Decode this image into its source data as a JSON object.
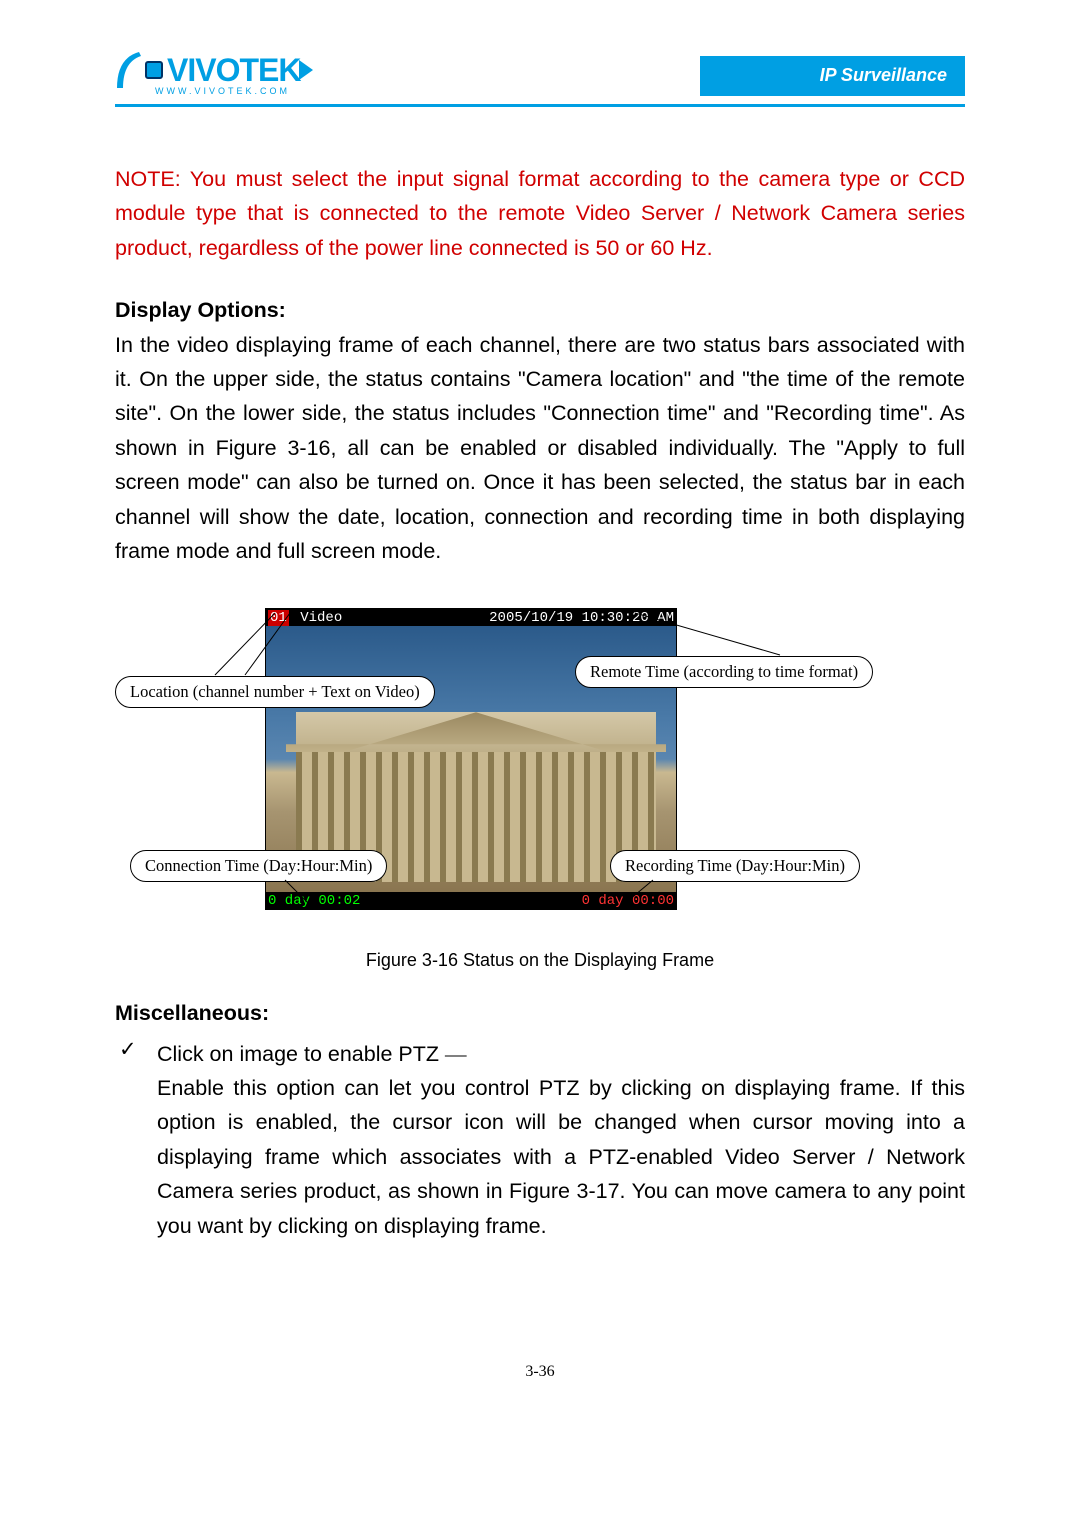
{
  "header": {
    "brand": "VIVOTEK",
    "brand_sub": "WWW.VIVOTEK.COM",
    "tagline": "IP Surveillance"
  },
  "note_text": "NOTE: You must select the input signal format according to the camera type or CCD module type that is connected to the remote Video Server / Network Camera series product, regardless of the power line connected is 50 or 60 Hz.",
  "display_options": {
    "heading": "Display Options:",
    "body": "In the video displaying frame of each channel, there are two status bars associated with it. On the upper side, the status contains \"Camera location\" and \"the time of the remote site\". On the lower side, the status includes \"Connection time\" and \"Recording time\". As shown in Figure 3-16, all can be enabled or disabled individually. The \"Apply to full screen mode\" can also be turned on. Once it has been selected, the status bar in each channel will show the date, location, connection and recording time in both displaying frame mode and full screen mode."
  },
  "figure": {
    "channel_num": "01",
    "channel_label": "Video",
    "remote_time": "2005/10/19 10:30:20 AM",
    "conn_time": "0 day  00:02",
    "rec_time": "0 day  00:00",
    "callout_location": "Location (channel number + Text on Video)",
    "callout_remote": "Remote Time (according to time format)",
    "callout_conn": "Connection Time (Day:Hour:Min)",
    "callout_rec": "Recording Time (Day:Hour:Min)",
    "caption": "Figure 3-16 Status on the Displaying Frame"
  },
  "misc": {
    "heading": "Miscellaneous:",
    "item_label": "Click on image to enable PTZ",
    "item_dash": "—",
    "item_body": "Enable this option can let you control PTZ by clicking on displaying frame. If this option is enabled, the cursor icon will be changed when cursor moving into a displaying frame which associates with a PTZ-enabled Video Server / Network Camera series product, as shown in Figure 3-17. You can move camera to any point you want by clicking on displaying frame."
  },
  "page_number": "3-36"
}
